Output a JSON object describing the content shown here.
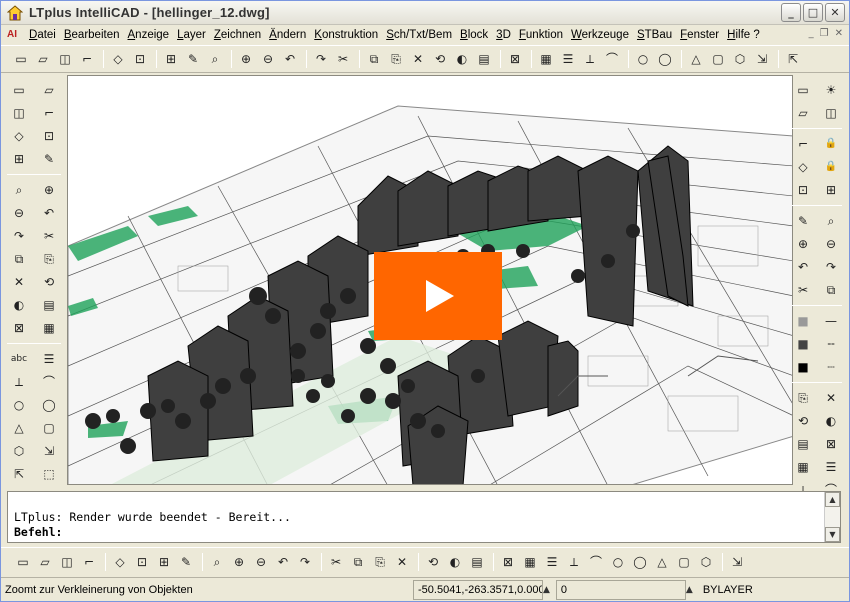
{
  "window": {
    "title": "LTplus IntelliCAD - [hellinger_12.dwg]",
    "app_icon": "house-icon",
    "buttons": [
      "minimize",
      "maximize",
      "close"
    ]
  },
  "menu": {
    "doc_icon_label": "AI",
    "items": [
      "Datei",
      "Bearbeiten",
      "Anzeige",
      "Layer",
      "Zeichnen",
      "Ändern",
      "Konstruktion",
      "Sch/Txt/Bem",
      "Block",
      "3D",
      "Funktion",
      "Werkzeuge",
      "STBau",
      "Fenster",
      "Hilfe ?"
    ]
  },
  "toolbar_top": {
    "icons": [
      "new-icon",
      "open-icon",
      "save-icon",
      "save-as-icon",
      "|",
      "print-icon",
      "print-preview-icon",
      "|",
      "cut-icon",
      "copy-icon",
      "paste-icon",
      "|",
      "delete-icon",
      "match-properties-icon",
      "insert-icon",
      "|",
      "undo-icon",
      "redo-icon",
      "|",
      "zoom-in-icon",
      "zoom-out-icon",
      "zoom-window-icon",
      "zoom-realtime-icon",
      "zoom-extents-icon",
      "zoom-previous-icon",
      "|",
      "render-icon",
      "|",
      "paint-icon",
      "hatch-icon",
      "layer-manager-icon",
      "image-icon",
      "|",
      "text-icon",
      "find-icon",
      "|",
      "view-icon",
      "named-views-icon",
      "zoom-all-icon",
      "pan-icon",
      "|",
      "shade-icon"
    ]
  },
  "toolbar_left": {
    "icons": [
      "line-icon",
      "polyline-icon",
      "arc-icon",
      "circle-icon",
      "point-icon",
      "ellipse-icon",
      "rectangle-icon",
      "polygon-icon",
      "|",
      "move-icon",
      "copy-object-icon",
      "rotate-icon",
      "scale-icon",
      "mirror-icon",
      "offset-icon",
      "array-icon",
      "trim-icon",
      "extend-icon",
      "break-icon",
      "fillet-icon",
      "chamfer-icon",
      "explode-icon",
      "stretch-icon",
      "|",
      "text-abc-icon",
      "mtext-icon",
      "spell-icon",
      "edit-text-icon",
      "attribute-icon",
      "field-icon",
      "dim-linear-icon",
      "dim-aligned-icon",
      "block-icon",
      "insert-block-icon",
      "wblock-icon",
      "xref-icon",
      "region-icon",
      "boundary-icon"
    ]
  },
  "toolbar_right": {
    "icons": [
      "layer-icon",
      "sun-icon",
      "layer-state-icon",
      "layer-freeze-icon",
      "|",
      "layer-on-icon",
      "layer-lock-icon",
      "layer-off-icon",
      "layer-unlock-icon",
      "layer-isolate-icon",
      "layer-walk-icon",
      "|",
      "layer-copy-icon",
      "layer-merge-icon",
      "layer-delete-icon",
      "layer-match-icon",
      "layer-prev-icon",
      "layer-next-icon",
      "layer-color-icon",
      "layer-linetype-icon",
      "|",
      "swatch-grey-icon",
      "linetype-continuous-icon",
      "swatch-dark-icon",
      "linetype-dashed-icon",
      "swatch-black-icon",
      "linetype-dotted-icon",
      "|",
      "snap-endpoint-icon",
      "snap-midpoint-icon",
      "snap-center-icon",
      "snap-node-icon",
      "snap-quadrant-icon",
      "snap-intersection-icon",
      "snap-insertion-icon",
      "snap-perpendicular-icon",
      "snap-tangent-icon",
      "snap-nearest-icon",
      "snap-apparent-icon",
      "snap-none-icon"
    ]
  },
  "canvas": {
    "play_icon": "play-icon",
    "colors": {
      "play": "#ff6600",
      "green": "#1fa35a",
      "building": "#3f3f3f"
    }
  },
  "command": {
    "line1": "LTplus: Render wurde beendet - Bereit...",
    "line2": "Befehl:"
  },
  "toolbar_bottom": {
    "icons": [
      "3d-orbit-icon",
      "3d-view-icon",
      "shade-flat-icon",
      "render-scene-icon",
      "|",
      "view-top-icon",
      "view-bottom-icon",
      "view-left-icon",
      "view-right-icon",
      "|",
      "ucs-icon",
      "ucs-world-icon",
      "ucs-object-icon",
      "ucs-view-icon",
      "ucs-origin-icon",
      "|",
      "render-light-icon",
      "render-material-icon",
      "render-background-icon",
      "render-fog-icon",
      "|",
      "ucs-z-icon",
      "ucs-x-icon",
      "ucs-3point-icon",
      "|",
      "box-icon",
      "wedge-icon",
      "cone-icon",
      "cylinder-icon",
      "sphere-icon",
      "torus-icon",
      "pyramid-icon",
      "dish-icon",
      "dome-icon",
      "mesh-icon",
      "|",
      "shading-icon"
    ]
  },
  "status": {
    "message": "Zoomt zur Verkleinerung von Objekten",
    "coordinates": "-50.5041,-263.3571,0.000",
    "field2": "0",
    "layer": "BYLAYER"
  }
}
